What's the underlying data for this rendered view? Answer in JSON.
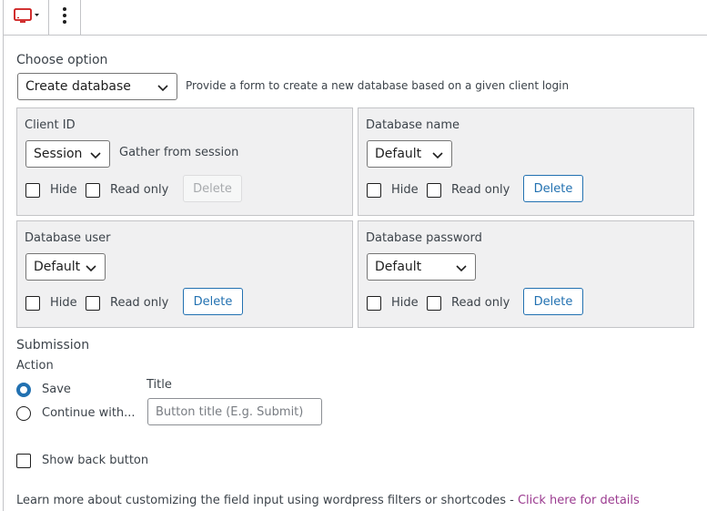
{
  "toolbar": {
    "block_icon": "monitor-icon",
    "more_icon": "more-vertical-icon"
  },
  "choose_option": {
    "label": "Choose option",
    "selected": "Create database",
    "description": "Provide a form to create a new database based on a given client login"
  },
  "fields": {
    "client_id": {
      "title": "Client ID",
      "selected": "Session",
      "note": "Gather from session",
      "hide": "Hide",
      "read_only": "Read only",
      "delete": "Delete"
    },
    "database_name": {
      "title": "Database name",
      "selected": "Default",
      "hide": "Hide",
      "read_only": "Read only",
      "delete": "Delete"
    },
    "database_user": {
      "title": "Database user",
      "selected": "Default",
      "hide": "Hide",
      "read_only": "Read only",
      "delete": "Delete"
    },
    "database_password": {
      "title": "Database password",
      "selected": "Default",
      "hide": "Hide",
      "read_only": "Read only",
      "delete": "Delete"
    }
  },
  "submission": {
    "heading": "Submission",
    "action_label": "Action",
    "options": [
      "Save",
      "Continue with..."
    ],
    "selected": "Save",
    "title_label": "Title",
    "title_placeholder": "Button title (E.g. Submit)",
    "show_back_button": "Show back button"
  },
  "footer": {
    "text": "Learn more about customizing the field input using wordpress filters or shortcodes - ",
    "link": "Click here for details"
  },
  "colors": {
    "accent": "#2271b1",
    "link": "#9b3b90",
    "icon_red": "#cc1818"
  }
}
